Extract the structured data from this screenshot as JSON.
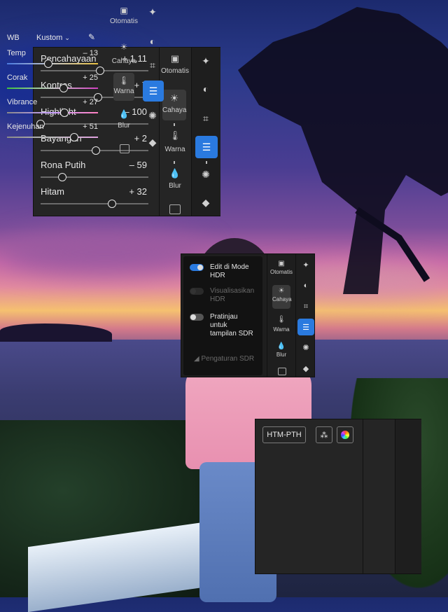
{
  "panel1": {
    "sliders": [
      {
        "label": "Pencahayaan",
        "value": "+ 1,11",
        "level": 0.55
      },
      {
        "label": "Kontras",
        "value": "+ 7",
        "level": 0.53
      },
      {
        "label": "Highlight",
        "value": "– 100",
        "level": 0.0
      },
      {
        "label": "Bayangan",
        "value": "+ 2",
        "level": 0.51
      },
      {
        "label": "Rona Putih",
        "value": "– 59",
        "level": 0.2
      },
      {
        "label": "Hitam",
        "value": "+ 32",
        "level": 0.66
      }
    ],
    "rail": {
      "auto": "Otomatis",
      "light": "Cahaya",
      "color": "Warna",
      "blur": "Blur"
    }
  },
  "panel2": {
    "hdr_edit": "Edit di Mode HDR",
    "hdr_edit_l1": "Edit di Mode",
    "hdr_edit_l2": "HDR",
    "visualize_l1": "Visualisasikan",
    "visualize_l2": "HDR",
    "preview_l1": "Pratinjau",
    "preview_l2": "untuk",
    "preview_l3": "tampilan SDR",
    "sdr_settings": "Pengaturan SDR",
    "rail": {
      "auto": "Otomatis",
      "light": "Cahaya",
      "color": "Warna",
      "blur": "Blur"
    }
  },
  "panel3": {
    "profile": "HTM-PTH",
    "wb_label": "WB",
    "wb_value": "Kustom",
    "sliders": [
      {
        "label": "Temp",
        "value": "– 13",
        "level": 0.45
      },
      {
        "label": "Corak",
        "value": "+ 25",
        "level": 0.62
      },
      {
        "label": "Vibrance",
        "value": "+ 27",
        "level": 0.63
      },
      {
        "label": "Kejenuhan",
        "value": "+ 51",
        "level": 0.74
      }
    ],
    "rail": {
      "auto": "Otomatis",
      "light": "Cahaya",
      "color": "Warna",
      "blur": "Blur"
    }
  },
  "colors": {
    "accent": "#2a7adf",
    "panel": "#252525"
  }
}
